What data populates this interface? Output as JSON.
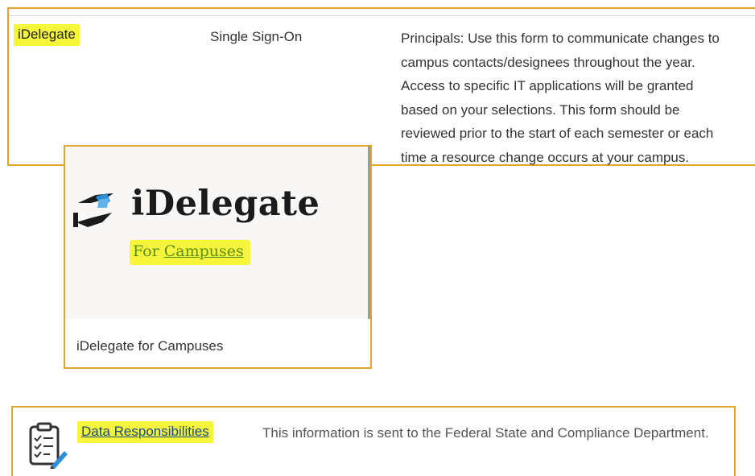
{
  "app_row": {
    "link_label": "iDelegate",
    "type": "Single Sign-On",
    "description_lines": [
      "Principals: Use this form to communicate changes to",
      "campus contacts/designees throughout the year.",
      "Access to specific IT applications will be granted",
      "based on your selections. This form should be",
      "reviewed prior to the start of each semester or each",
      "time a resource change occurs at your campus."
    ]
  },
  "card": {
    "logo_title": "iDelegate",
    "logo_sub_for": "For",
    "logo_sub_campuses": "Campuses",
    "caption": "iDelegate for Campuses"
  },
  "responsibilities": {
    "link_label": "Data Responsibilities",
    "description": "This information is sent to the Federal State and Compliance Department."
  },
  "colors": {
    "highlight": "#f5f53b",
    "border": "#e0a52a",
    "logo_green": "#5a8f1e",
    "icon_blue": "#2e8fd6"
  }
}
